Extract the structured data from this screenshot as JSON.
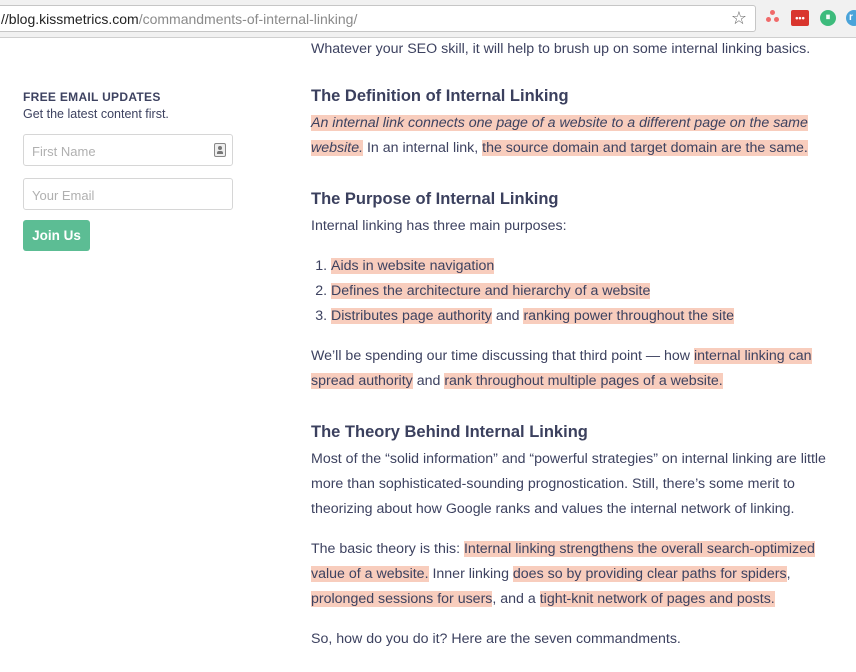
{
  "browser": {
    "url_host": "//blog.kissmetrics.com",
    "url_path": "/commandments-of-internal-linking/",
    "ext_red_label": "•••"
  },
  "sidebar": {
    "title": "FREE EMAIL UPDATES",
    "subtitle": "Get the latest content first.",
    "first_name_placeholder": "First Name",
    "email_placeholder": "Your Email",
    "join_label": "Join Us"
  },
  "article": {
    "intro": "Whatever your SEO skill, it will help to brush up on some internal linking basics.",
    "h_definition": "The Definition of Internal Linking",
    "def_hl1": "An internal link connects one page of a website to a different page on the same website.",
    "def_mid": " In an internal link, ",
    "def_hl2": "the source domain and target domain are the same.",
    "h_purpose": "The Purpose of Internal Linking",
    "purpose_intro": "Internal linking has three main purposes:",
    "list": {
      "item1": "Aids in website navigation",
      "item2": "Defines the architecture and hierarchy of a website",
      "item3_a": "Distributes page authority",
      "item3_and": " and ",
      "item3_b": "ranking power throughout the site"
    },
    "spend_a": "We’ll be spending our time discussing that third point — how ",
    "spend_hl1": "internal linking can spread authority",
    "spend_and": " and ",
    "spend_hl2": "rank throughout multiple pages of a website.",
    "h_theory": "The Theory Behind Internal Linking",
    "theory_p": "Most of the “solid information” and “powerful strategies” on internal linking are little more than sophisticated-sounding prognostication. Still, there’s some merit to theorizing about how Google ranks and values the internal network of linking.",
    "basic_a": "The basic theory is this: ",
    "basic_hl1": "Internal linking strengthens the overall search-optimized value of a website.",
    "basic_b": " Inner linking ",
    "basic_hl2": "does so by providing clear paths for spiders",
    "basic_c": ", ",
    "basic_hl3": "prolonged sessions for users",
    "basic_d": ", and a ",
    "basic_hl4": "tight-knit network of pages and posts.",
    "closing": "So, how do you do it? Here are the seven commandments."
  }
}
